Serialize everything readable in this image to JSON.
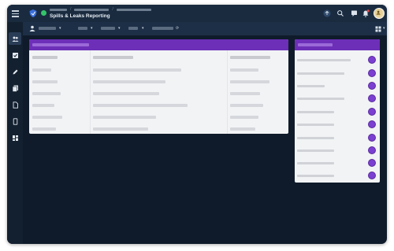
{
  "app": {
    "title": "Spills & Leaks Reporting"
  },
  "icons": {
    "menu": "hamburger-icon",
    "logo": "shield-icon",
    "status": "online-dot",
    "upload": "upload-icon",
    "search": "search-icon",
    "chat": "chat-icon",
    "notifications": "bell-icon",
    "avatar": "user-avatar"
  },
  "sidebar": {
    "items": [
      {
        "name": "people-icon",
        "active": true
      },
      {
        "name": "checkbox-icon",
        "active": false
      },
      {
        "name": "pencil-icon",
        "active": false
      },
      {
        "name": "documents-icon",
        "active": false
      },
      {
        "name": "file-icon",
        "active": false
      },
      {
        "name": "tablet-icon",
        "active": false
      },
      {
        "name": "dashboard-icon",
        "active": false
      }
    ]
  },
  "colors": {
    "accent": "#6d2fb8",
    "background": "#0f1b2a",
    "topbar": "#1a2b40",
    "online": "#33c46a",
    "notification": "#e5484d"
  }
}
